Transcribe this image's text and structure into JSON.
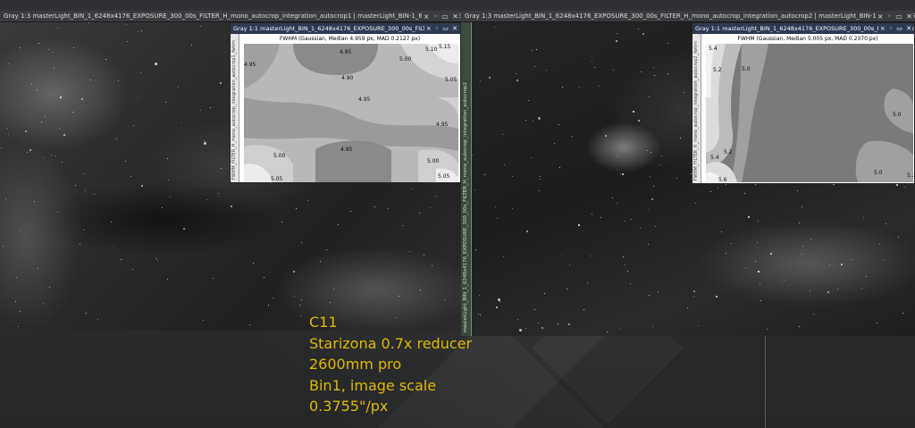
{
  "left_window": {
    "title": "Gray 1:3 masterLight_BIN_1_6248x4176_EXPOSURE_300_00s_FILTER_H_mono_autocrop_integration_autocrop1 | masterLight_BIN-1_6248x4176_EXPOSURE-300.00s_FILTER...",
    "controls": "× ◦ ▭ ✕"
  },
  "right_window": {
    "title": "Gray 1:3 masterLight_BIN_1_6248x4176_EXPOSURE_300_00s_FILTER_H_mono_autocrop_integration_autocrop2 | masterLight_BIN-1_6248x4176_EXPOSURE-300.00s_FIL...",
    "controls": "× ◦ ▭ ✕",
    "side_label": "masterLight_BIN_1_6248x4176_EXPOSURE_300_00s_FILTER_H_mono_autocrop_integration_autocrop2"
  },
  "left_map": {
    "title": "Gray 1:1 masterLight_BIN_1_6248x4176_EXPOSURE_300_00s_FILTER_...",
    "controls": "× ◦ ▭ ✕",
    "side_label": "FWHM_FILTER_H_mono_autocrop_integration_autocrop1_fwhm",
    "caption": "FWHM (Gaussian, Median 4.959 px, MAD 0.2127 px)",
    "labels": [
      "4.85",
      "5.10",
      "5.15",
      "4.95",
      "5.00",
      "4.90",
      "5.05",
      "4.95",
      "4.95",
      "5.00",
      "4.95",
      "5.00",
      "5.05",
      "5.05"
    ]
  },
  "right_map": {
    "title": "Gray 1:1 masterLight_BIN_1_6248x4176_EXPOSURE_300_00s_FILTER_H_mono...",
    "controls": "× ◦ ▭ ✕",
    "side_label": "FWHM_FILTER_H_mono_autocrop_integration_autocrop2_fwhm",
    "caption": "FWHM (Gaussian, Median 5.005 px, MAD 0.2370 px)",
    "labels": [
      "5.4",
      "5.2",
      "5.0",
      "5.0",
      "5.4",
      "5.2",
      "5.6",
      "5.0",
      "5.2"
    ]
  },
  "caption": {
    "line1": "C11",
    "line2": "Starizona 0.7x reducer",
    "line3": "2600mm pro",
    "line4": "Bin1, image scale",
    "line5": "0.3755\"/px"
  },
  "colors": {
    "caption_text": "#e0b800",
    "map_title_bar": "#2d3a52"
  }
}
